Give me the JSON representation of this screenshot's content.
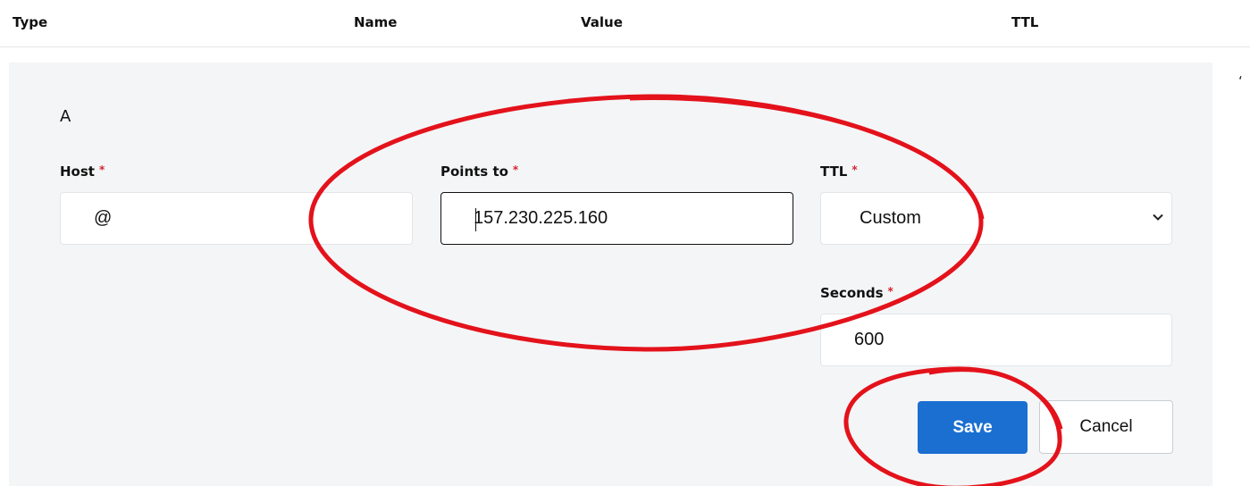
{
  "columns": {
    "type": "Type",
    "name": "Name",
    "value": "Value",
    "ttl": "TTL"
  },
  "record": {
    "type": "A",
    "host": {
      "label": "Host",
      "required_mark": "*",
      "value": "@"
    },
    "points_to": {
      "label": "Points to",
      "required_mark": "*",
      "value": "157.230.225.160"
    },
    "ttl": {
      "label": "TTL",
      "required_mark": "*",
      "selected": "Custom"
    },
    "seconds": {
      "label": "Seconds",
      "required_mark": "*",
      "value": "600"
    }
  },
  "actions": {
    "save_label": "Save",
    "cancel_label": "Cancel"
  },
  "colors": {
    "primary": "#1a6fd1",
    "required": "#d3242e",
    "annotation": "#e3121b",
    "panel": "#f4f5f7"
  },
  "icons": {
    "ttl_select": "chevron-down-icon"
  }
}
